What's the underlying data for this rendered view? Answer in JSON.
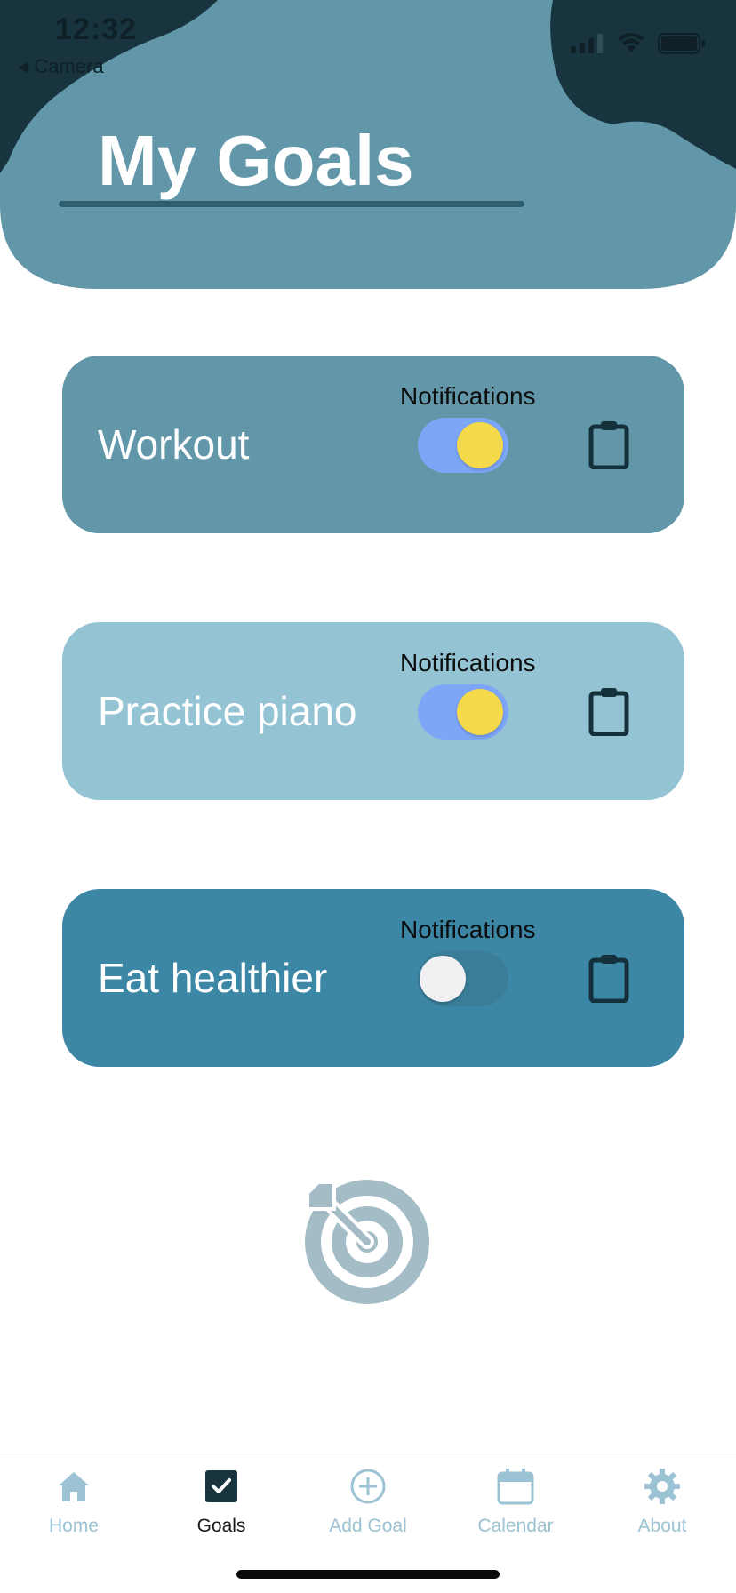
{
  "status_bar": {
    "time": "12:32",
    "back_label": "Camera"
  },
  "header": {
    "title": "My Goals"
  },
  "goals": [
    {
      "name": "Workout",
      "notifications_label": "Notifications",
      "notifications_on": true,
      "color": "#6297aa"
    },
    {
      "name": "Practice piano",
      "notifications_label": "Notifications",
      "notifications_on": true,
      "color": "#94c3d3"
    },
    {
      "name": "Eat healthier",
      "notifications_label": "Notifications",
      "notifications_on": false,
      "color": "#3d87a6"
    }
  ],
  "tabs": [
    {
      "label": "Home",
      "icon": "home-icon",
      "active": false
    },
    {
      "label": "Goals",
      "icon": "checkbox-icon",
      "active": true
    },
    {
      "label": "Add Goal",
      "icon": "add-circle-icon",
      "active": false
    },
    {
      "label": "Calendar",
      "icon": "calendar-icon",
      "active": false
    },
    {
      "label": "About",
      "icon": "gear-icon",
      "active": false
    }
  ],
  "colors": {
    "header_light": "#6297aa",
    "header_dark": "#17343f",
    "toggle_on_track": "#7ea6f7",
    "toggle_on_knob": "#f4d94a",
    "tab_inactive": "#9cc3d3",
    "tab_active": "#1b1b1b"
  }
}
